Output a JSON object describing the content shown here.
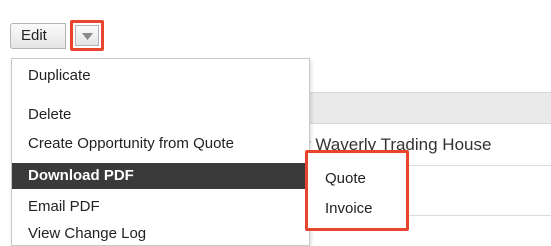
{
  "toolbar": {
    "edit_label": "Edit"
  },
  "menu": {
    "items": [
      {
        "label": "Duplicate"
      },
      {
        "label": "Delete"
      },
      {
        "label": "Create Opportunity from Quote"
      },
      {
        "label": "Download PDF",
        "active": true
      },
      {
        "label": "Email PDF"
      },
      {
        "label": "View Change Log"
      }
    ]
  },
  "submenu": {
    "items": [
      {
        "label": "Quote"
      },
      {
        "label": "Invoice"
      }
    ]
  },
  "background": {
    "record_name_partial": "r Waverly Trading House"
  },
  "colors": {
    "highlight": "#e8452f",
    "active_item": "#3a3a3a"
  }
}
